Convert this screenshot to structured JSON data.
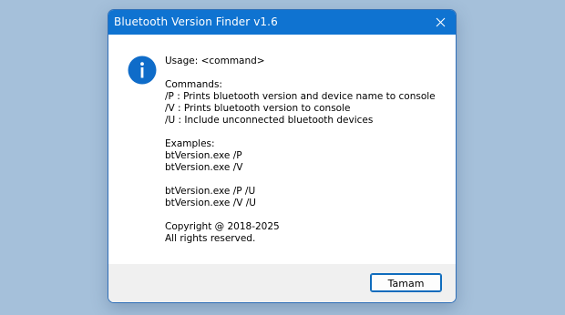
{
  "window": {
    "title": "Bluetooth Version Finder v1.6",
    "close_icon": "close-icon"
  },
  "message": {
    "icon": "info-icon",
    "usage": "Usage: <command>",
    "commands_header": "Commands:",
    "commands": [
      "/P : Prints bluetooth version and device name to console",
      "/V : Prints bluetooth version to console",
      "/U : Include unconnected bluetooth devices"
    ],
    "examples_header": "Examples:",
    "examples": [
      "btVersion.exe /P",
      "btVersion.exe /V",
      "btVersion.exe /P /U",
      "btVersion.exe /V /U"
    ],
    "copyright": "Copyright @ 2018-2025",
    "rights": "All rights reserved."
  },
  "buttons": {
    "ok_label": "Tamam"
  },
  "colors": {
    "titlebar": "#0f73d1",
    "desktop": "#a5c0da",
    "footer": "#f0f0f0",
    "button_border": "#0f6cbd"
  }
}
